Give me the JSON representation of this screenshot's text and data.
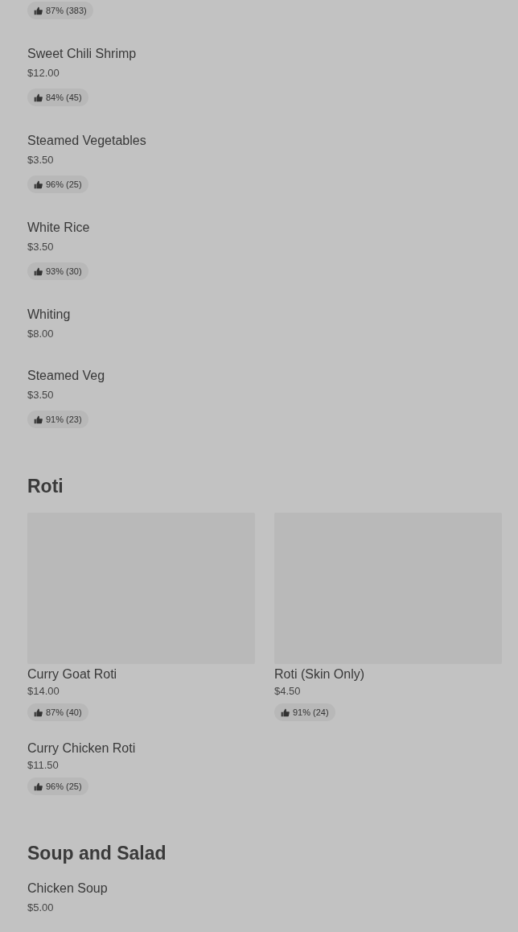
{
  "sections": [
    {
      "kind": "list",
      "items": [
        {
          "rating": "87% (383)"
        },
        {
          "name": "Sweet Chili Shrimp",
          "price": "$12.00",
          "rating": "84% (45)"
        },
        {
          "name": "Steamed Vegetables",
          "price": "$3.50",
          "rating": "96% (25)"
        },
        {
          "name": "White Rice",
          "price": "$3.50",
          "rating": "93% (30)"
        },
        {
          "name": "Whiting",
          "price": "$8.00"
        },
        {
          "name": "Steamed Veg",
          "price": "$3.50",
          "rating": "91% (23)"
        }
      ]
    },
    {
      "title": "Roti",
      "kind": "grid",
      "items": [
        {
          "kind": "photo_card",
          "name": "Curry Goat Roti",
          "price": "$14.00",
          "rating": "87% (40)"
        },
        {
          "kind": "photo_card",
          "name": "Roti (Skin Only)",
          "price": "$4.50",
          "rating": "91% (24)"
        },
        {
          "kind": "card",
          "name": "Curry Chicken Roti",
          "price": "$11.50",
          "rating": "96% (25)"
        }
      ]
    },
    {
      "title": "Soup and Salad",
      "kind": "list",
      "items": [
        {
          "name": "Chicken Soup",
          "price": "$5.00"
        }
      ]
    }
  ]
}
